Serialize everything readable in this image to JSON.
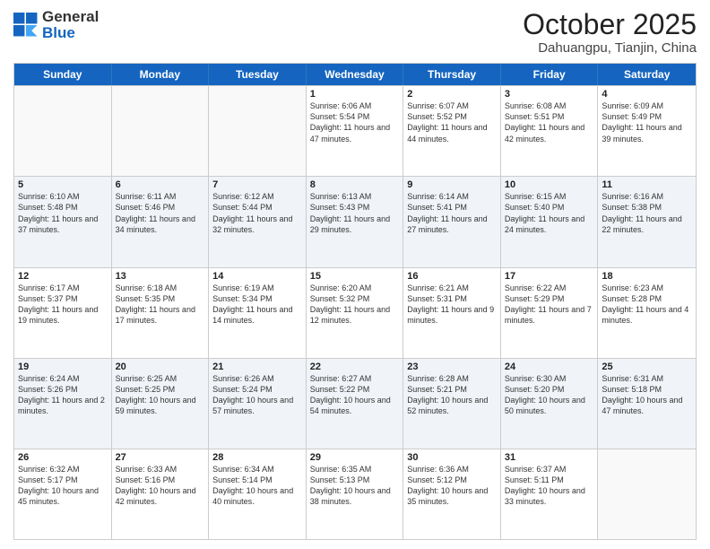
{
  "logo": {
    "general": "General",
    "blue": "Blue"
  },
  "title": "October 2025",
  "location": "Dahuangpu, Tianjin, China",
  "days_of_week": [
    "Sunday",
    "Monday",
    "Tuesday",
    "Wednesday",
    "Thursday",
    "Friday",
    "Saturday"
  ],
  "weeks": [
    [
      {
        "day": "",
        "empty": true
      },
      {
        "day": "",
        "empty": true
      },
      {
        "day": "",
        "empty": true
      },
      {
        "day": "1",
        "sunrise": "6:06 AM",
        "sunset": "5:54 PM",
        "daylight": "11 hours and 47 minutes."
      },
      {
        "day": "2",
        "sunrise": "6:07 AM",
        "sunset": "5:52 PM",
        "daylight": "11 hours and 44 minutes."
      },
      {
        "day": "3",
        "sunrise": "6:08 AM",
        "sunset": "5:51 PM",
        "daylight": "11 hours and 42 minutes."
      },
      {
        "day": "4",
        "sunrise": "6:09 AM",
        "sunset": "5:49 PM",
        "daylight": "11 hours and 39 minutes."
      }
    ],
    [
      {
        "day": "5",
        "sunrise": "6:10 AM",
        "sunset": "5:48 PM",
        "daylight": "11 hours and 37 minutes."
      },
      {
        "day": "6",
        "sunrise": "6:11 AM",
        "sunset": "5:46 PM",
        "daylight": "11 hours and 34 minutes."
      },
      {
        "day": "7",
        "sunrise": "6:12 AM",
        "sunset": "5:44 PM",
        "daylight": "11 hours and 32 minutes."
      },
      {
        "day": "8",
        "sunrise": "6:13 AM",
        "sunset": "5:43 PM",
        "daylight": "11 hours and 29 minutes."
      },
      {
        "day": "9",
        "sunrise": "6:14 AM",
        "sunset": "5:41 PM",
        "daylight": "11 hours and 27 minutes."
      },
      {
        "day": "10",
        "sunrise": "6:15 AM",
        "sunset": "5:40 PM",
        "daylight": "11 hours and 24 minutes."
      },
      {
        "day": "11",
        "sunrise": "6:16 AM",
        "sunset": "5:38 PM",
        "daylight": "11 hours and 22 minutes."
      }
    ],
    [
      {
        "day": "12",
        "sunrise": "6:17 AM",
        "sunset": "5:37 PM",
        "daylight": "11 hours and 19 minutes."
      },
      {
        "day": "13",
        "sunrise": "6:18 AM",
        "sunset": "5:35 PM",
        "daylight": "11 hours and 17 minutes."
      },
      {
        "day": "14",
        "sunrise": "6:19 AM",
        "sunset": "5:34 PM",
        "daylight": "11 hours and 14 minutes."
      },
      {
        "day": "15",
        "sunrise": "6:20 AM",
        "sunset": "5:32 PM",
        "daylight": "11 hours and 12 minutes."
      },
      {
        "day": "16",
        "sunrise": "6:21 AM",
        "sunset": "5:31 PM",
        "daylight": "11 hours and 9 minutes."
      },
      {
        "day": "17",
        "sunrise": "6:22 AM",
        "sunset": "5:29 PM",
        "daylight": "11 hours and 7 minutes."
      },
      {
        "day": "18",
        "sunrise": "6:23 AM",
        "sunset": "5:28 PM",
        "daylight": "11 hours and 4 minutes."
      }
    ],
    [
      {
        "day": "19",
        "sunrise": "6:24 AM",
        "sunset": "5:26 PM",
        "daylight": "11 hours and 2 minutes."
      },
      {
        "day": "20",
        "sunrise": "6:25 AM",
        "sunset": "5:25 PM",
        "daylight": "10 hours and 59 minutes."
      },
      {
        "day": "21",
        "sunrise": "6:26 AM",
        "sunset": "5:24 PM",
        "daylight": "10 hours and 57 minutes."
      },
      {
        "day": "22",
        "sunrise": "6:27 AM",
        "sunset": "5:22 PM",
        "daylight": "10 hours and 54 minutes."
      },
      {
        "day": "23",
        "sunrise": "6:28 AM",
        "sunset": "5:21 PM",
        "daylight": "10 hours and 52 minutes."
      },
      {
        "day": "24",
        "sunrise": "6:30 AM",
        "sunset": "5:20 PM",
        "daylight": "10 hours and 50 minutes."
      },
      {
        "day": "25",
        "sunrise": "6:31 AM",
        "sunset": "5:18 PM",
        "daylight": "10 hours and 47 minutes."
      }
    ],
    [
      {
        "day": "26",
        "sunrise": "6:32 AM",
        "sunset": "5:17 PM",
        "daylight": "10 hours and 45 minutes."
      },
      {
        "day": "27",
        "sunrise": "6:33 AM",
        "sunset": "5:16 PM",
        "daylight": "10 hours and 42 minutes."
      },
      {
        "day": "28",
        "sunrise": "6:34 AM",
        "sunset": "5:14 PM",
        "daylight": "10 hours and 40 minutes."
      },
      {
        "day": "29",
        "sunrise": "6:35 AM",
        "sunset": "5:13 PM",
        "daylight": "10 hours and 38 minutes."
      },
      {
        "day": "30",
        "sunrise": "6:36 AM",
        "sunset": "5:12 PM",
        "daylight": "10 hours and 35 minutes."
      },
      {
        "day": "31",
        "sunrise": "6:37 AM",
        "sunset": "5:11 PM",
        "daylight": "10 hours and 33 minutes."
      },
      {
        "day": "",
        "empty": true
      }
    ]
  ],
  "labels": {
    "sunrise": "Sunrise:",
    "sunset": "Sunset:",
    "daylight": "Daylight:"
  }
}
